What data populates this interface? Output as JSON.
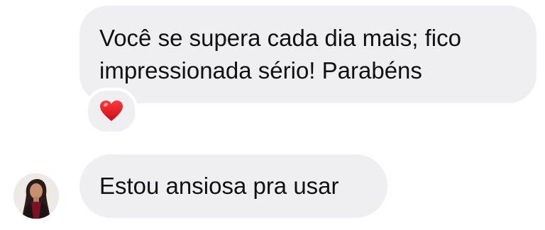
{
  "messages": [
    {
      "text": "Você se supera cada dia mais; fico impressionada sério! Parabéns",
      "reaction": "heart-icon"
    },
    {
      "text": "Estou ansiosa pra usar"
    }
  ],
  "colors": {
    "bubble": "#efeff1",
    "heart": "#e0131e",
    "background": "#ffffff"
  },
  "avatar": {
    "icon": "user-avatar"
  }
}
